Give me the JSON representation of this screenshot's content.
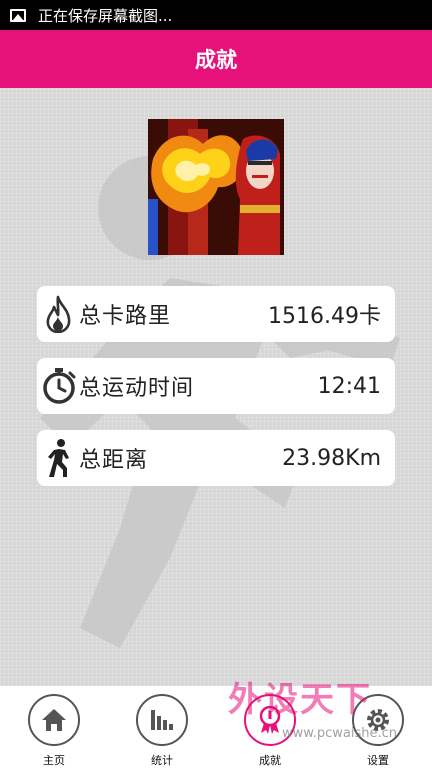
{
  "status_bar": {
    "text": "正在保存屏幕截图..."
  },
  "header": {
    "title": "成就"
  },
  "stats": [
    {
      "label": "总卡路里",
      "value": "1516.49卡",
      "icon": "flame-icon"
    },
    {
      "label": "总运动时间",
      "value": "12:41",
      "icon": "stopwatch-icon"
    },
    {
      "label": "总距离",
      "value": "23.98Km",
      "icon": "walking-person-icon"
    }
  ],
  "nav": {
    "items": [
      {
        "label": "主页",
        "icon": "home-icon",
        "active": false
      },
      {
        "label": "统计",
        "icon": "bar-chart-icon",
        "active": false
      },
      {
        "label": "成就",
        "icon": "award-icon",
        "active": true
      },
      {
        "label": "设置",
        "icon": "gear-icon",
        "active": false
      }
    ]
  },
  "watermark": {
    "text": "外设天下",
    "url": "www.pcwaishe.cn"
  },
  "colors": {
    "accent": "#e6117a",
    "background": "#d6d6d6",
    "card": "#ffffff"
  }
}
